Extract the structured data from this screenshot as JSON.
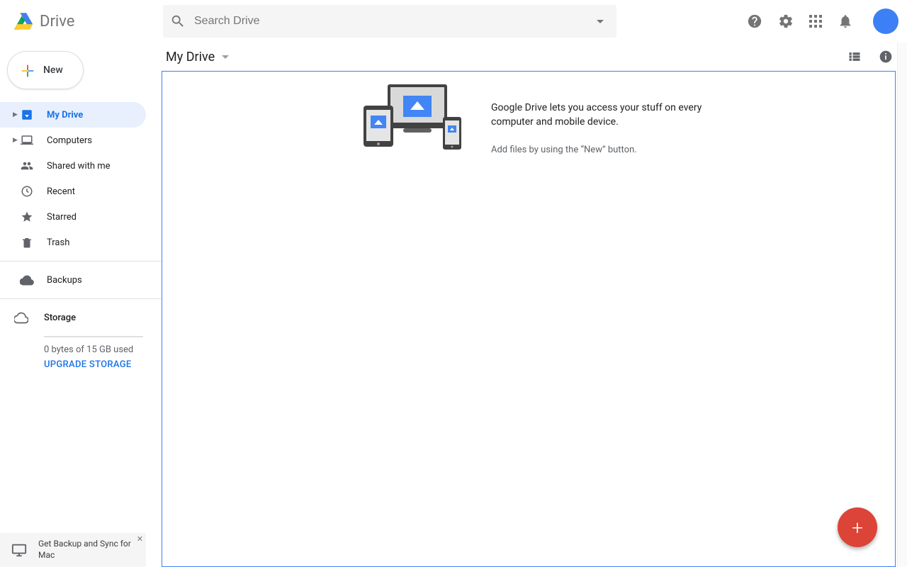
{
  "app": {
    "title": "Drive"
  },
  "search": {
    "placeholder": "Search Drive"
  },
  "new_button": {
    "label": "New"
  },
  "sidebar": {
    "items": [
      {
        "label": "My Drive"
      },
      {
        "label": "Computers"
      },
      {
        "label": "Shared with me"
      },
      {
        "label": "Recent"
      },
      {
        "label": "Starred"
      },
      {
        "label": "Trash"
      }
    ],
    "backups_label": "Backups",
    "storage": {
      "label": "Storage",
      "used_text": "0 bytes of 15 GB used",
      "upgrade_label": "UPGRADE STORAGE"
    }
  },
  "promo": {
    "label": "Get Backup and Sync for Mac"
  },
  "breadcrumb": {
    "label": "My Drive"
  },
  "empty": {
    "headline": "Google Drive lets you access your stuff on every computer and mobile device.",
    "subline": "Add files by using the “New” button."
  }
}
